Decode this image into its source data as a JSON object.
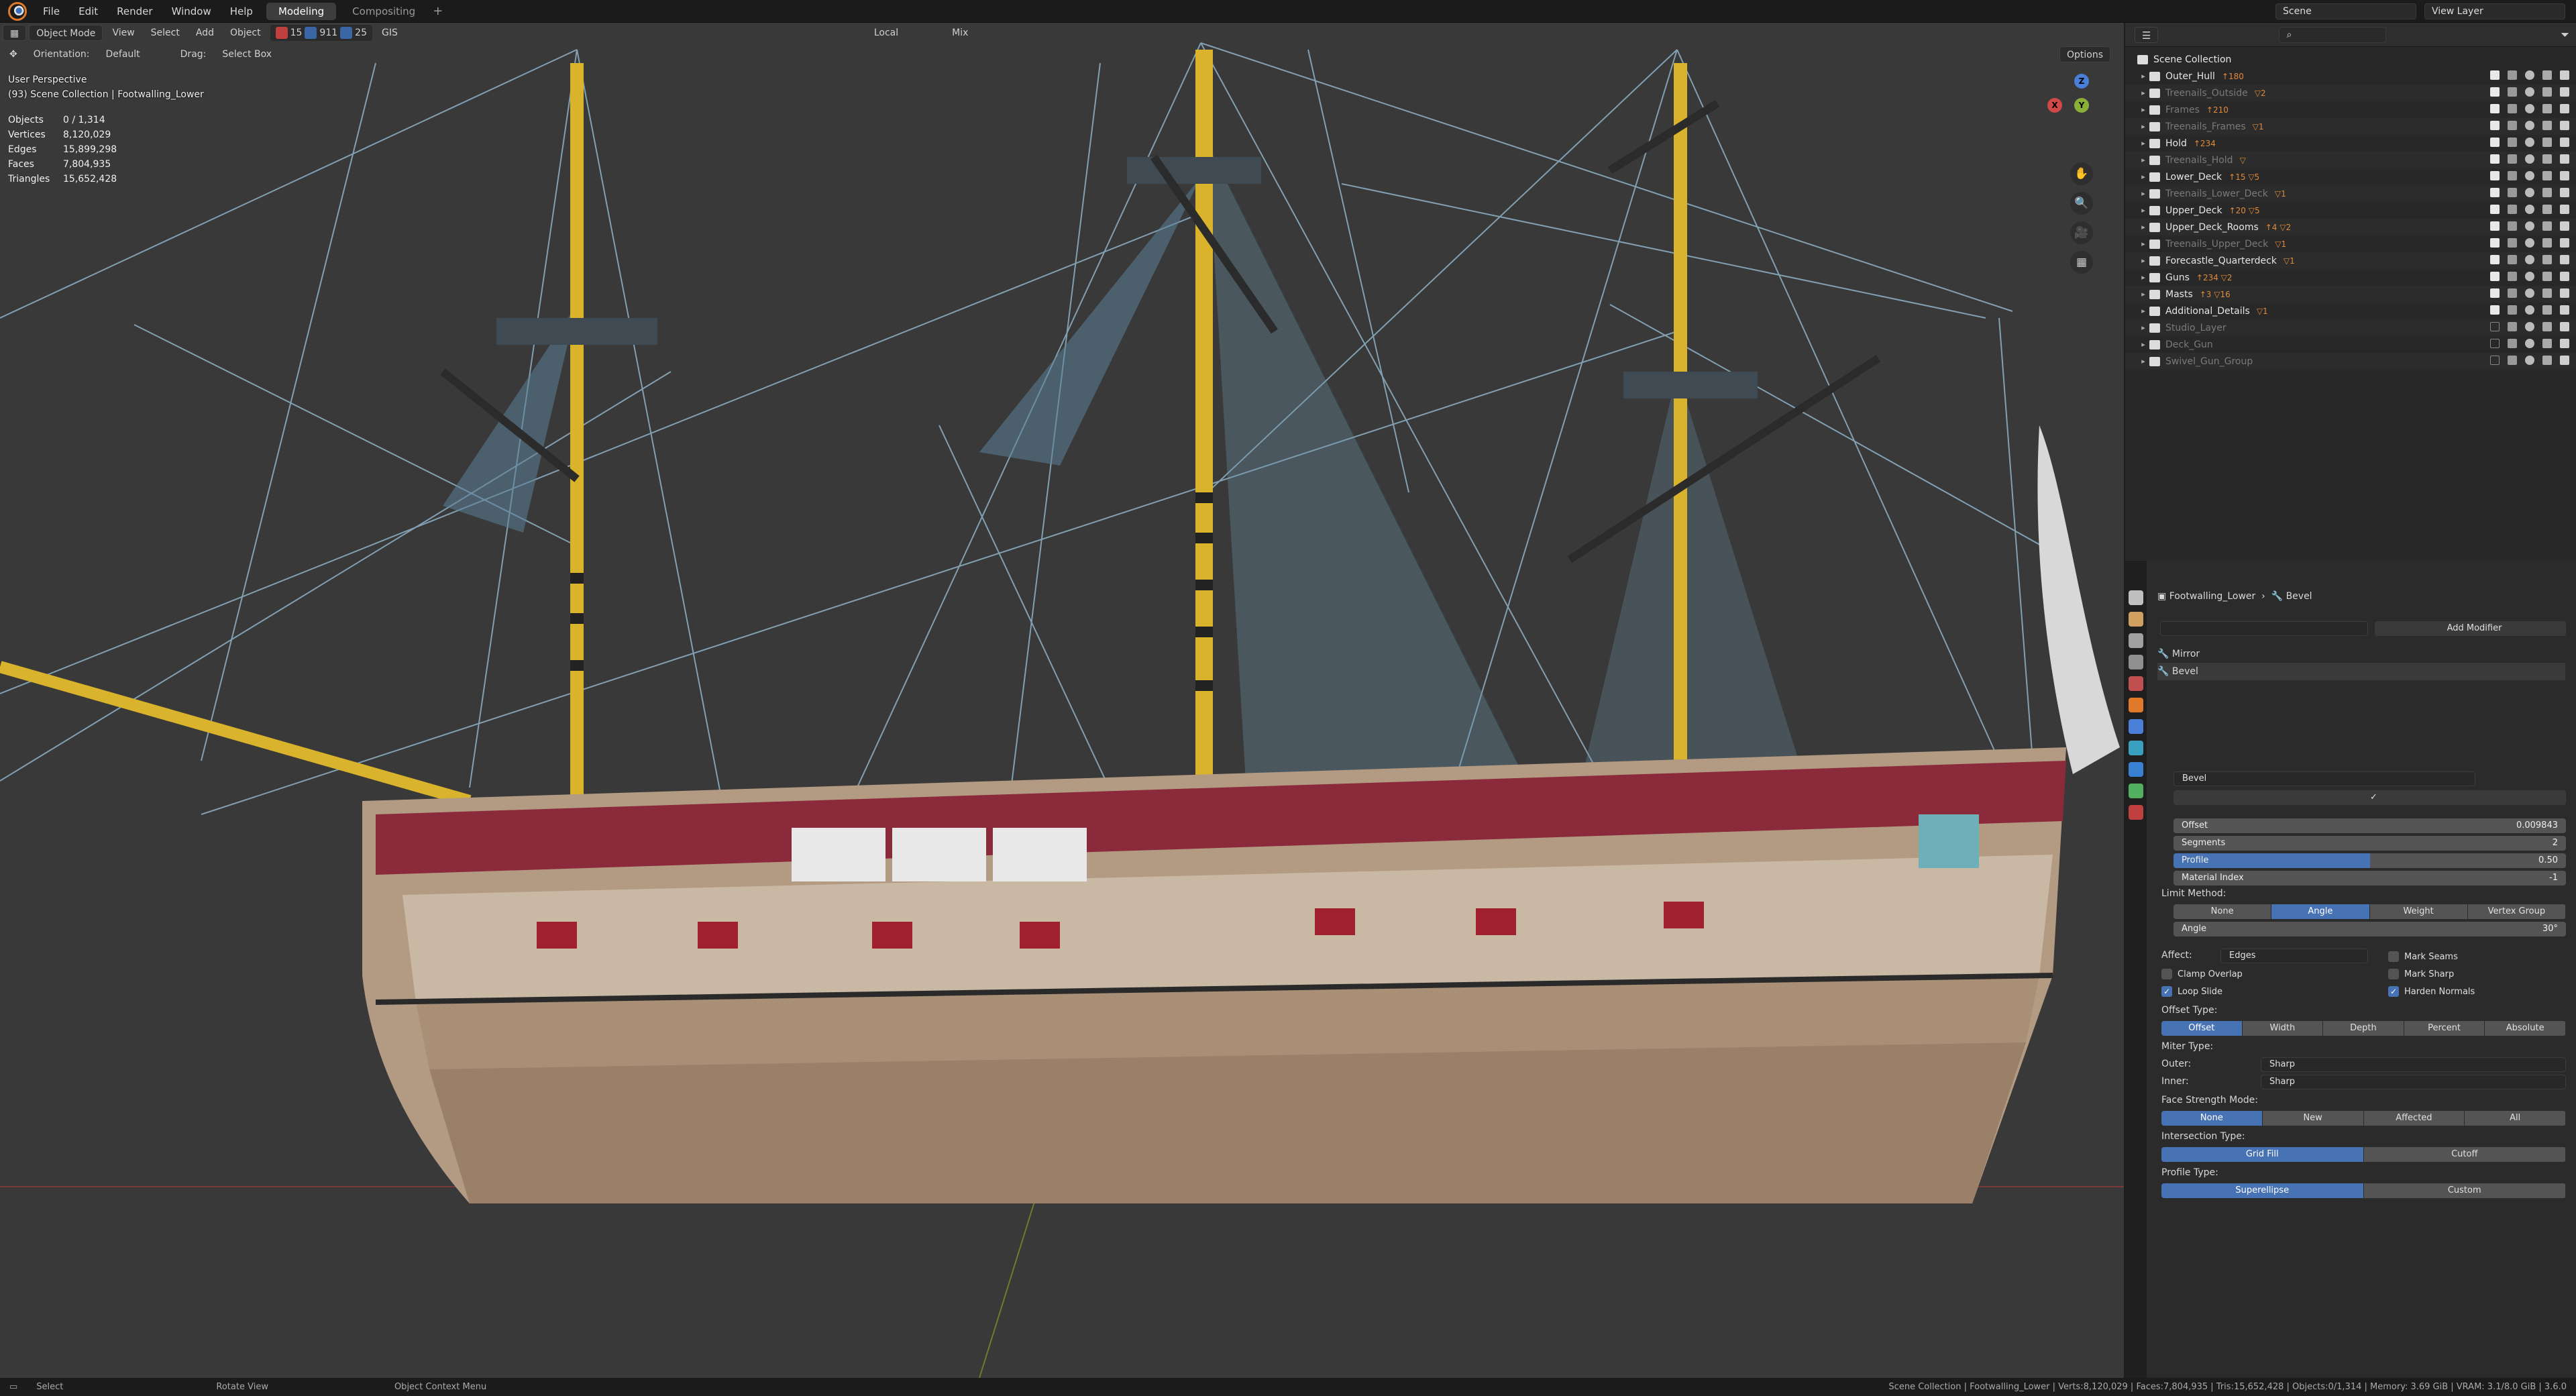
{
  "menu": [
    "File",
    "Edit",
    "Render",
    "Window",
    "Help"
  ],
  "workspaces": [
    {
      "label": "Modeling",
      "active": true
    },
    {
      "label": "Compositing",
      "active": false
    }
  ],
  "topbar": {
    "scene": "Scene",
    "view_layer": "View Layer"
  },
  "viewport": {
    "mode": "Object Mode",
    "menus": [
      "View",
      "Select",
      "Add",
      "Object"
    ],
    "selection_counts": [
      "15",
      "911",
      "25"
    ],
    "gis": "GIS",
    "transform_orientation": "Local",
    "proportional": "Mix",
    "orientation_label": "Orientation:",
    "orientation_value": "Default",
    "drag_label": "Drag:",
    "drag_value": "Select Box",
    "options": "Options",
    "view_name": "User Perspective",
    "context": "(93) Scene Collection | Footwalling_Lower",
    "stats": [
      {
        "k": "Objects",
        "v": "0 / 1,314"
      },
      {
        "k": "Vertices",
        "v": "8,120,029"
      },
      {
        "k": "Edges",
        "v": "15,899,298"
      },
      {
        "k": "Faces",
        "v": "7,804,935"
      },
      {
        "k": "Triangles",
        "v": "15,652,428"
      }
    ],
    "gizmo": {
      "z": "Z",
      "y": "Y",
      "x": "X"
    }
  },
  "outliner": {
    "root": "Scene Collection",
    "rows": [
      {
        "name": "Outer_Hull",
        "dim": false,
        "extra": "↑180",
        "checked": true
      },
      {
        "name": "Treenails_Outside",
        "dim": true,
        "extra": "▽2",
        "checked": true
      },
      {
        "name": "Frames",
        "dim": true,
        "extra": "↑210",
        "checked": true
      },
      {
        "name": "Treenails_Frames",
        "dim": true,
        "extra": "▽1",
        "checked": true
      },
      {
        "name": "Hold",
        "dim": false,
        "extra": "↑234",
        "checked": true
      },
      {
        "name": "Treenails_Hold",
        "dim": true,
        "extra": "▽",
        "checked": true
      },
      {
        "name": "Lower_Deck",
        "dim": false,
        "extra": "↑15 ▽5",
        "checked": true
      },
      {
        "name": "Treenails_Lower_Deck",
        "dim": true,
        "extra": "▽1",
        "checked": true
      },
      {
        "name": "Upper_Deck",
        "dim": false,
        "extra": "↑20 ▽5",
        "checked": true
      },
      {
        "name": "Upper_Deck_Rooms",
        "dim": false,
        "extra": "↑4 ▽2",
        "checked": true
      },
      {
        "name": "Treenails_Upper_Deck",
        "dim": true,
        "extra": "▽1",
        "checked": true
      },
      {
        "name": "Forecastle_Quarterdeck",
        "dim": false,
        "extra": "▽1",
        "checked": true
      },
      {
        "name": "Guns",
        "dim": false,
        "extra": "↑234 ▽2",
        "checked": true
      },
      {
        "name": "Masts",
        "dim": false,
        "extra": "↑3 ▽16",
        "checked": true
      },
      {
        "name": "Additional_Details",
        "dim": false,
        "extra": "▽1",
        "checked": true
      },
      {
        "name": "Studio_Layer",
        "dim": true,
        "extra": "",
        "checked": false
      },
      {
        "name": "Deck_Gun",
        "dim": true,
        "extra": "",
        "checked": false
      },
      {
        "name": "Swivel_Gun_Group",
        "dim": true,
        "extra": "",
        "checked": false
      }
    ]
  },
  "properties": {
    "breadcrumb_object": "Footwalling_Lower",
    "breadcrumb_modifier": "Bevel",
    "add_modifier": "Add Modifier",
    "modifiers": [
      "Mirror",
      "Bevel"
    ],
    "modifier_name": "Bevel",
    "offset_label": "Offset",
    "offset_value": "0.009843",
    "segments_label": "Segments",
    "segments_value": "2",
    "profile_label": "Profile",
    "profile_value": "0.50",
    "profile_fraction": 0.5,
    "material_index_label": "Material Index",
    "material_index_value": "-1",
    "limit_method_label": "Limit Method:",
    "limit_methods": [
      "None",
      "Angle",
      "Weight",
      "Vertex Group"
    ],
    "limit_method_active": "Angle",
    "angle_label": "Angle",
    "angle_value": "30°",
    "affect_label": "Affect:",
    "affect_value": "Edges",
    "mark_seams": "Mark Seams",
    "clamp_overlap": "Clamp Overlap",
    "mark_sharp": "Mark Sharp",
    "loop_slide": "Loop Slide",
    "harden_normals": "Harden Normals",
    "offset_type_label": "Offset Type:",
    "offset_types": [
      "Offset",
      "Width",
      "Depth",
      "Percent",
      "Absolute"
    ],
    "offset_type_active": "Offset",
    "miter_type_label": "Miter Type:",
    "outer_label": "Outer:",
    "outer_value": "Sharp",
    "inner_label": "Inner:",
    "inner_value": "Sharp",
    "face_strength_label": "Face Strength Mode:",
    "face_strengths": [
      "None",
      "New",
      "Affected",
      "All"
    ],
    "face_strength_active": "None",
    "intersection_label": "Intersection Type:",
    "intersections": [
      "Grid Fill",
      "Cutoff"
    ],
    "intersection_active": "Grid Fill",
    "profile_type_label": "Profile Type:",
    "profile_types": [
      "Superellipse",
      "Custom"
    ],
    "profile_type_active": "Superellipse"
  },
  "statusbar": {
    "select": "Select",
    "rotate": "Rotate View",
    "context_menu": "Object Context Menu",
    "info": "Scene Collection | Footwalling_Lower | Verts:8,120,029 | Faces:7,804,935 | Tris:15,652,428 | Objects:0/1,314 | Memory: 3.69 GiB | VRAM: 3.1/8.0 GiB | 3.6.0"
  },
  "colors": {
    "accent": "#4772b3",
    "viewport_bg": "#393939",
    "hull": "#b39a82",
    "mast_yellow": "#e0b830",
    "rigging": "#7ea6bf"
  }
}
